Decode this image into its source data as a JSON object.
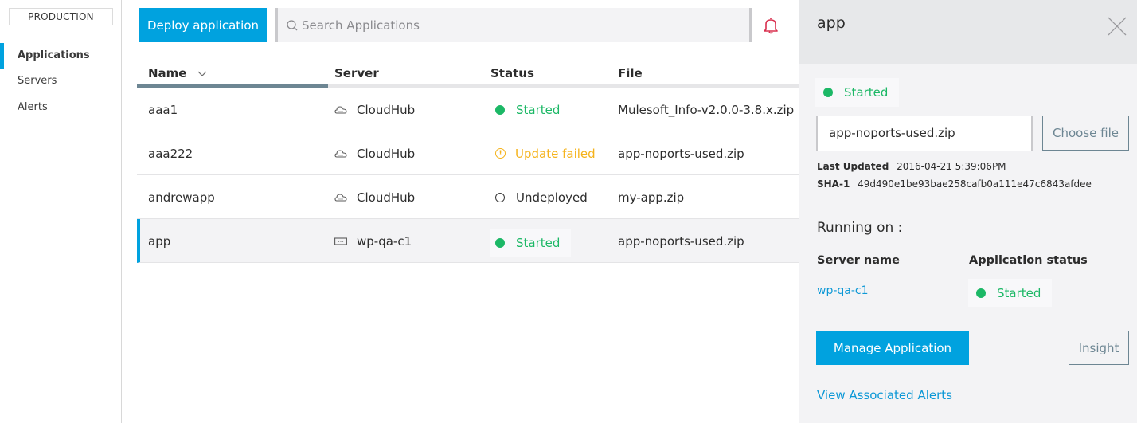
{
  "sidebar": {
    "environment": "PRODUCTION",
    "items": [
      {
        "label": "Applications",
        "active": true
      },
      {
        "label": "Servers",
        "active": false
      },
      {
        "label": "Alerts",
        "active": false
      }
    ]
  },
  "toolbar": {
    "deploy_label": "Deploy application",
    "search_placeholder": "Search Applications",
    "search_value": "",
    "search_icon": "search-icon",
    "notifications_icon": "bell-icon"
  },
  "table": {
    "columns": [
      {
        "label": "Name",
        "sort": "descending"
      },
      {
        "label": "Server"
      },
      {
        "label": "Status"
      },
      {
        "label": "File"
      }
    ],
    "rows": [
      {
        "name": "aaa1",
        "server": "CloudHub",
        "server_icon": "cloud-icon",
        "status": "Started",
        "status_type": "started",
        "file": "Mulesoft_Info-v2.0.0-3.8.x.zip",
        "selected": false
      },
      {
        "name": "aaa222",
        "server": "CloudHub",
        "server_icon": "cloud-icon",
        "status": "Update failed",
        "status_type": "failed",
        "file": "app-noports-used.zip",
        "selected": false
      },
      {
        "name": "andrewapp",
        "server": "CloudHub",
        "server_icon": "cloud-icon",
        "status": "Undeployed",
        "status_type": "undeployed",
        "file": "my-app.zip",
        "selected": false
      },
      {
        "name": "app",
        "server": "wp-qa-c1",
        "server_icon": "server-icon",
        "status": "Started",
        "status_type": "started",
        "file": "app-noports-used.zip",
        "selected": true
      }
    ]
  },
  "panel": {
    "title": "app",
    "status": "Started",
    "file_name": "app-noports-used.zip",
    "choose_file_label": "Choose file",
    "last_updated_label": "Last Updated",
    "last_updated_value": "2016-04-21 5:39:06PM",
    "sha_label": "SHA-1",
    "sha_value": "49d490e1be93bae258cafb0a111e47c6843afdee",
    "running_on_label": "Running on :",
    "server_name_header": "Server name",
    "app_status_header": "Application status",
    "server_name": "wp-qa-c1",
    "app_status": "Started",
    "manage_label": "Manage Application",
    "insight_label": "Insight",
    "alerts_link": "View Associated Alerts"
  },
  "colors": {
    "accent": "#00a2df",
    "started": "#1cb866",
    "failed": "#f5b31c",
    "alert": "#d9304f",
    "link": "#0d98d6"
  }
}
